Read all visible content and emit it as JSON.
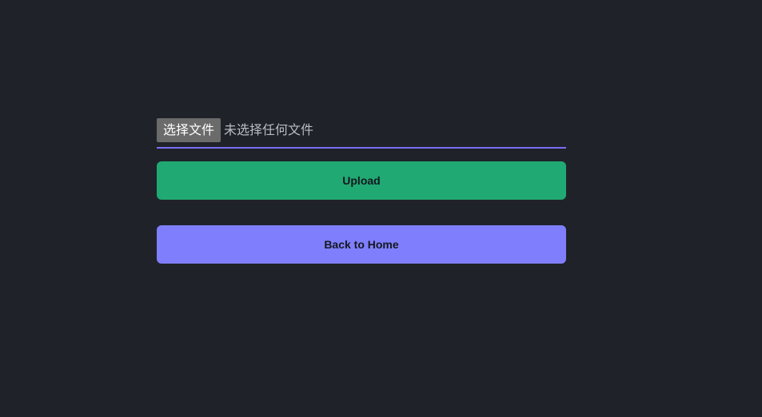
{
  "file_input": {
    "button_label": "选择文件",
    "status_text": "未选择任何文件"
  },
  "actions": {
    "upload_label": "Upload",
    "home_label": "Back to Home"
  },
  "colors": {
    "background": "#1f2329",
    "file_underline": "#7b6cf6",
    "upload_button": "#20a973",
    "home_button": "#7f7ffd"
  }
}
